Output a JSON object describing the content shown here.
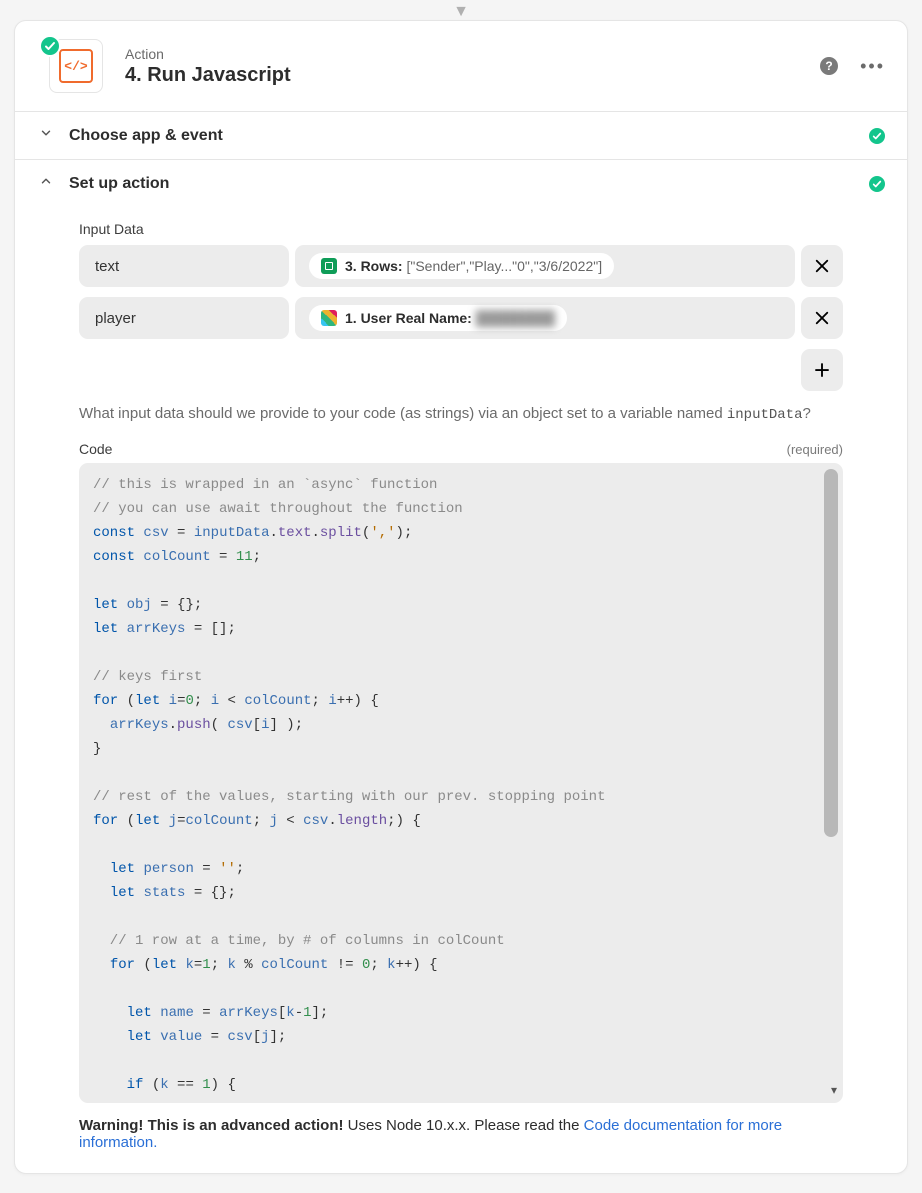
{
  "header": {
    "action_label": "Action",
    "title": "4. Run Javascript",
    "app_icon_text": "</>"
  },
  "sections": {
    "choose": "Choose app & event",
    "setup": "Set up action"
  },
  "input_data": {
    "label": "Input Data",
    "rows": [
      {
        "key": "text",
        "chip_prefix": "3. Rows:",
        "chip_value": "[\"Sender\",\"Play...\"0\",\"3/6/2022\"]",
        "icon": "sheets"
      },
      {
        "key": "player",
        "chip_prefix": "1. User Real Name:",
        "chip_value": "████████",
        "icon": "slack"
      }
    ],
    "helper": "What input data should we provide to your code (as strings) via an object set to a variable named",
    "helper_code": "inputData",
    "helper_tail": "?"
  },
  "code": {
    "label": "Code",
    "required": "(required)",
    "lines": [
      "// this is wrapped in an `async` function",
      "// you can use await throughout the function",
      "const csv = inputData.text.split(',');",
      "const colCount = 11;",
      "",
      "let obj = {};",
      "let arrKeys = [];",
      "",
      "// keys first",
      "for (let i=0; i < colCount; i++) {",
      "  arrKeys.push( csv[i] );",
      "}",
      "",
      "// rest of the values, starting with our prev. stopping point",
      "for (let j=colCount; j < csv.length;) {",
      "",
      "  let person = '';",
      "  let stats = {};",
      "",
      "  // 1 row at a time, by # of columns in colCount",
      "  for (let k=1; k % colCount != 0; k++) {",
      "",
      "    let name = arrKeys[k-1];",
      "    let value = csv[j];",
      "",
      "    if (k == 1) {"
    ]
  },
  "warning": {
    "bold": "Warning! This is an advanced action!",
    "text": " Uses Node 10.x.x. Please read the ",
    "link": "Code documentation for more information."
  }
}
